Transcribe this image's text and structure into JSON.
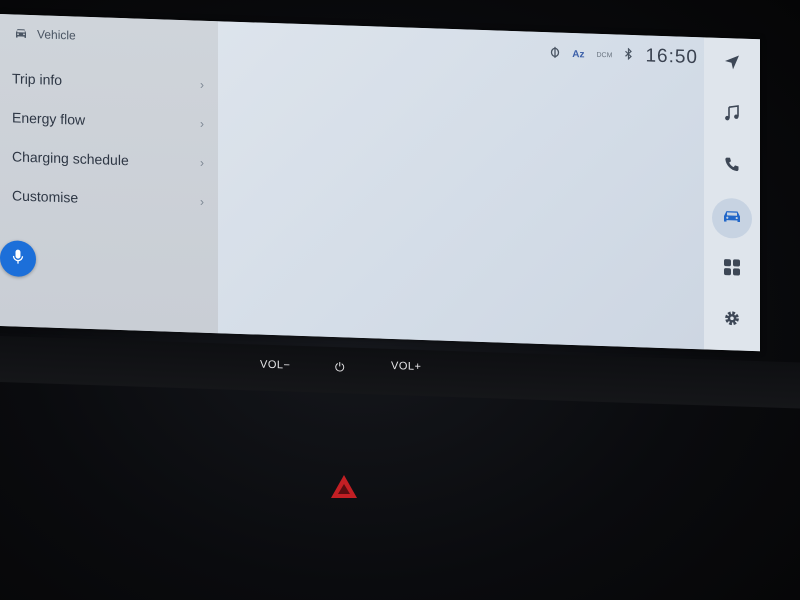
{
  "header": {
    "title": "Vehicle",
    "icon": "car-icon"
  },
  "menu": {
    "items": [
      {
        "label": "Trip info"
      },
      {
        "label": "Energy flow"
      },
      {
        "label": "Charging schedule"
      },
      {
        "label": "Customise"
      }
    ],
    "chevron": "›"
  },
  "status": {
    "time": "16:50",
    "az_label": "Az",
    "dcm_label": "DCM",
    "icons": [
      "wireless-charging-icon",
      "az-icon",
      "dcm-icon",
      "bluetooth-icon"
    ]
  },
  "sidebar": {
    "items": [
      {
        "name": "navigation",
        "icon": "navigation-arrow-icon"
      },
      {
        "name": "media",
        "icon": "music-note-icon"
      },
      {
        "name": "phone",
        "icon": "phone-icon"
      },
      {
        "name": "vehicle",
        "icon": "car-icon",
        "active": true
      },
      {
        "name": "apps",
        "icon": "apps-grid-icon"
      },
      {
        "name": "settings",
        "icon": "gear-icon"
      }
    ]
  },
  "hardware": {
    "vol_down": "VOL−",
    "power": "⏻",
    "vol_up": "VOL+"
  },
  "colors": {
    "accent": "#1c6fd9",
    "hazard": "#c21f24"
  }
}
